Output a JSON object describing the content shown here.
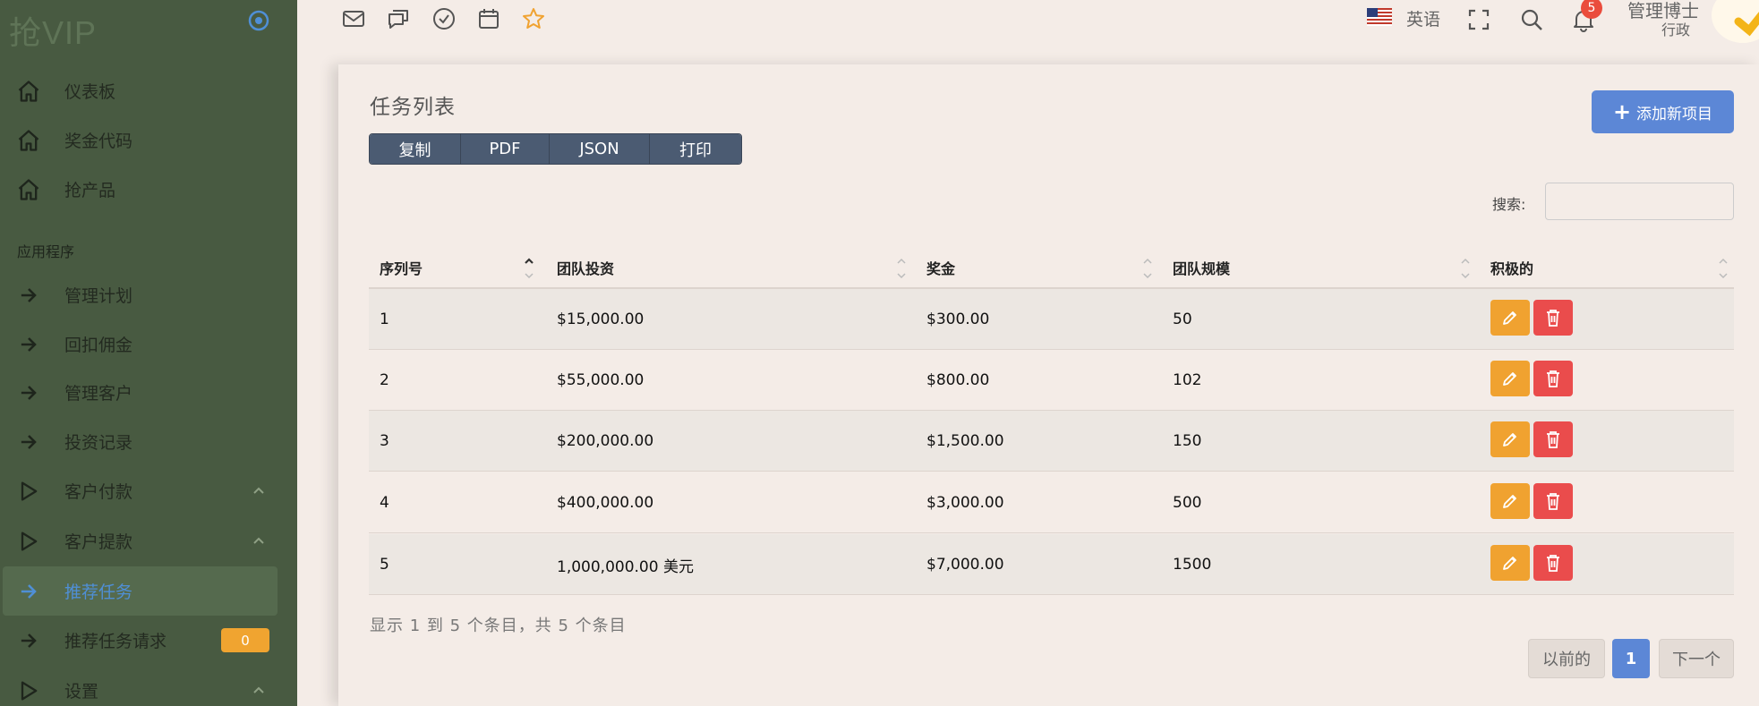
{
  "brand": {
    "name": "抢VIP"
  },
  "sidebar": {
    "top_items": [
      {
        "label": "仪表板",
        "icon": "home-icon"
      },
      {
        "label": "奖金代码",
        "icon": "home-icon"
      },
      {
        "label": "抢产品",
        "icon": "home-icon"
      }
    ],
    "section_title": "应用程序",
    "items": [
      {
        "label": "管理计划",
        "icon": "arrow-right-icon"
      },
      {
        "label": "回扣佣金",
        "icon": "arrow-right-icon"
      },
      {
        "label": "管理客户",
        "icon": "arrow-right-icon"
      },
      {
        "label": "投资记录",
        "icon": "arrow-right-icon"
      },
      {
        "label": "客户付款",
        "icon": "play-icon",
        "chevron": "chevron-up-icon"
      },
      {
        "label": "客户提款",
        "icon": "play-icon",
        "chevron": "chevron-up-icon"
      },
      {
        "label": "推荐任务",
        "icon": "arrow-right-icon",
        "active": true
      },
      {
        "label": "推荐任务请求",
        "icon": "arrow-right-icon",
        "badge": "0"
      },
      {
        "label": "设置",
        "icon": "play-icon",
        "chevron": "chevron-up-icon"
      }
    ]
  },
  "topbar": {
    "icons": [
      "mail-icon",
      "chat-icon",
      "check-circle-icon",
      "calendar-icon",
      "star-icon"
    ],
    "language": "英语",
    "notification_count": "5",
    "user_name": "管理博士",
    "user_role": "行政"
  },
  "card": {
    "title": "任务列表",
    "add_button": "添加新项目",
    "export_buttons": [
      "复制",
      "PDF",
      "JSON",
      "打印"
    ],
    "search_label": "搜索:",
    "search_value": ""
  },
  "table": {
    "columns": [
      "序列号",
      "团队投资",
      "奖金",
      "团队规模",
      "积极的"
    ],
    "rows": [
      {
        "id": "1",
        "investment": "$15,000.00",
        "bonus": "$300.00",
        "size": "50"
      },
      {
        "id": "2",
        "investment": "$55,000.00",
        "bonus": "$800.00",
        "size": "102"
      },
      {
        "id": "3",
        "investment": "$200,000.00",
        "bonus": "$1,500.00",
        "size": "150"
      },
      {
        "id": "4",
        "investment": "$400,000.00",
        "bonus": "$3,000.00",
        "size": "500"
      },
      {
        "id": "5",
        "investment": "1,000,000.00 美元",
        "bonus": "$7,000.00",
        "size": "1500"
      }
    ]
  },
  "footer": {
    "info": "显示 1 到 5 个条目，共 5 个条目",
    "prev": "以前的",
    "page": "1",
    "next": "下一个"
  },
  "colors": {
    "sidebar_bg": "#485a41",
    "page_bg": "#f4ece7",
    "accent_blue": "#5c87d6",
    "edit_orange": "#f0a230",
    "delete_red": "#ea4c4c",
    "export_btn": "#4b5b72"
  }
}
